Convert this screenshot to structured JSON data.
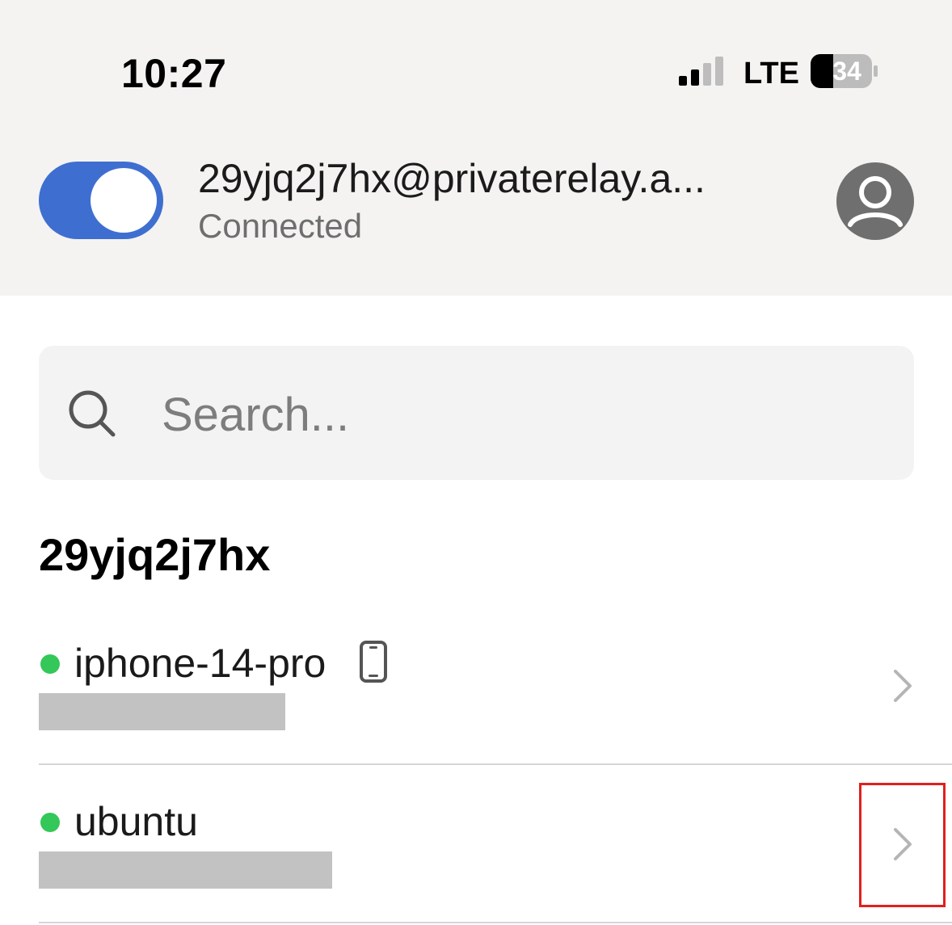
{
  "status_bar": {
    "time": "10:27",
    "network": "LTE",
    "battery_level": "34"
  },
  "account": {
    "email": "29yjq2j7hx@privaterelay.a...",
    "status": "Connected",
    "vpn_enabled": true,
    "accent_color": "#3e6fd0"
  },
  "search": {
    "placeholder": "Search..."
  },
  "section": {
    "title": "29yjq2j7hx"
  },
  "devices": [
    {
      "name": "iphone-14-pro",
      "online": true,
      "icon": "phone-icon",
      "ip": "",
      "status_color": "#34c759"
    },
    {
      "name": "ubuntu",
      "online": true,
      "icon": "",
      "ip": "",
      "status_color": "#34c759"
    }
  ]
}
